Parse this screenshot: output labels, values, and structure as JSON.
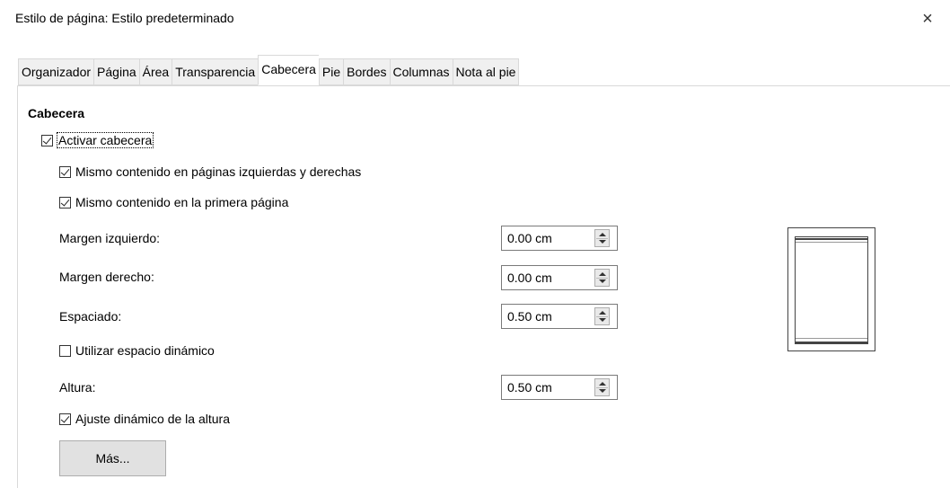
{
  "window": {
    "title": "Estilo de página: Estilo predeterminado",
    "close_label": "×"
  },
  "tabs": [
    {
      "label": "Organizador",
      "active": false
    },
    {
      "label": "Página",
      "active": false
    },
    {
      "label": "Área",
      "active": false
    },
    {
      "label": "Transparencia",
      "active": false
    },
    {
      "label": "Cabecera",
      "active": true
    },
    {
      "label": "Pie",
      "active": false
    },
    {
      "label": "Bordes",
      "active": false
    },
    {
      "label": "Columnas",
      "active": false
    },
    {
      "label": "Nota al pie",
      "active": false
    }
  ],
  "header_section": {
    "heading": "Cabecera",
    "activate": {
      "label": "Activar cabecera",
      "checked": true
    },
    "same_left_right": {
      "label": "Mismo contenido en páginas izquierdas y derechas",
      "checked": true
    },
    "same_first_page": {
      "label": "Mismo contenido en la primera página",
      "checked": true
    },
    "left_margin": {
      "label": "Margen izquierdo:",
      "value": "0.00 cm"
    },
    "right_margin": {
      "label": "Margen derecho:",
      "value": "0.00 cm"
    },
    "spacing": {
      "label": "Espaciado:",
      "value": "0.50 cm"
    },
    "dynamic_spacing": {
      "label": "Utilizar espacio dinámico",
      "checked": false
    },
    "height": {
      "label": "Altura:",
      "value": "0.50 cm"
    },
    "autofit_height": {
      "label": "Ajuste dinámico de la altura",
      "checked": true
    },
    "more_button": "Más..."
  }
}
